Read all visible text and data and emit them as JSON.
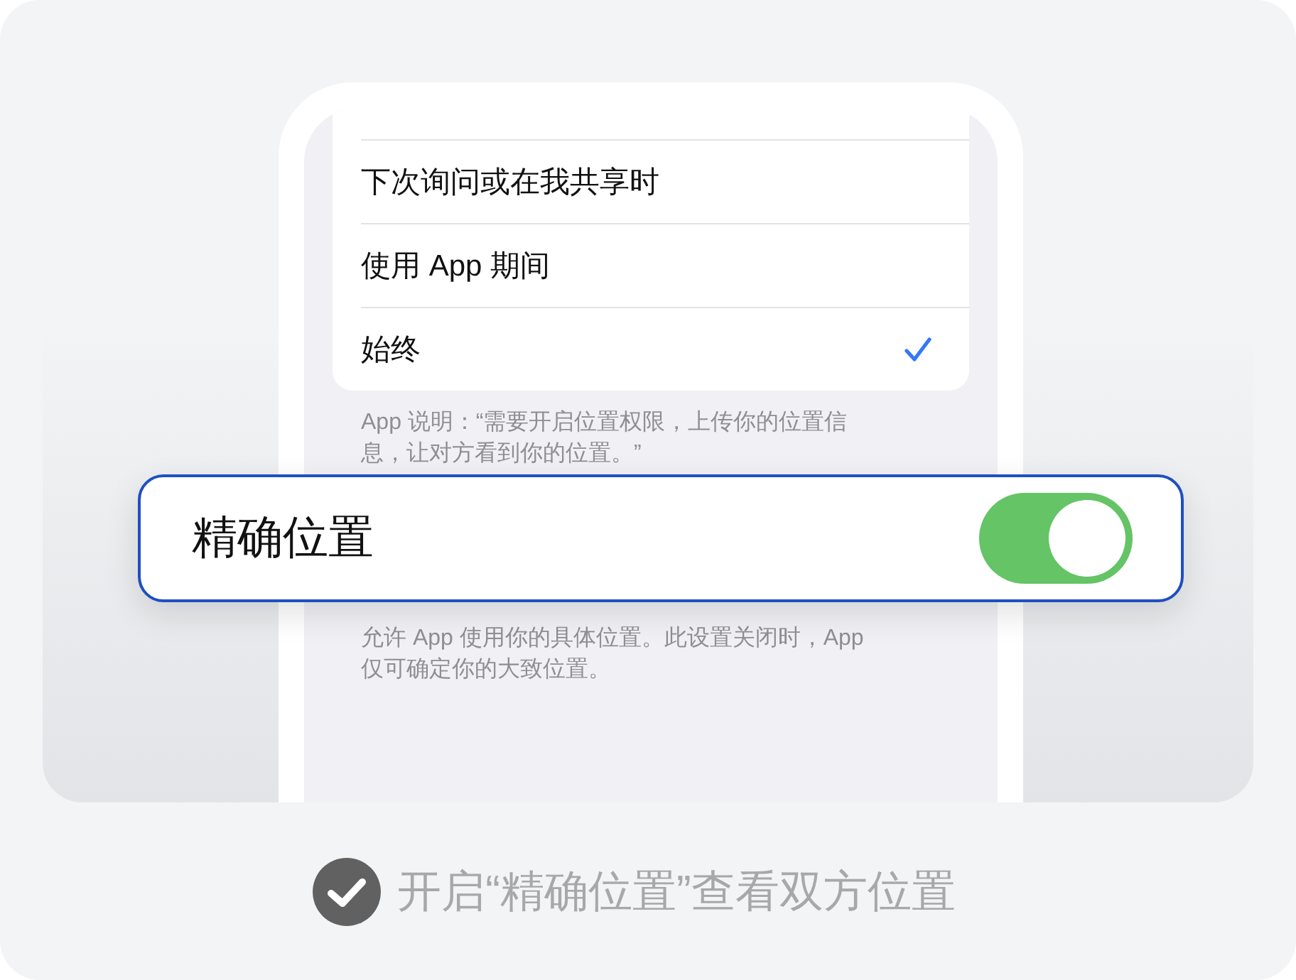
{
  "options": [
    {
      "label": "下次询问或在我共享时",
      "selected": false
    },
    {
      "label": "使用 App 期间",
      "selected": false
    },
    {
      "label": "始终",
      "selected": true
    }
  ],
  "app_note": "App 说明：“需要开启位置权限，上传你的位置信息，让对方看到你的位置。”",
  "precise_location": {
    "label": "精确位置",
    "on": true
  },
  "precise_note": "允许 App 使用你的具体位置。此设置关闭时，App 仅可确定你的大致位置。",
  "caption": {
    "text": "开启“精确位置”查看双方位置",
    "checked": true
  }
}
